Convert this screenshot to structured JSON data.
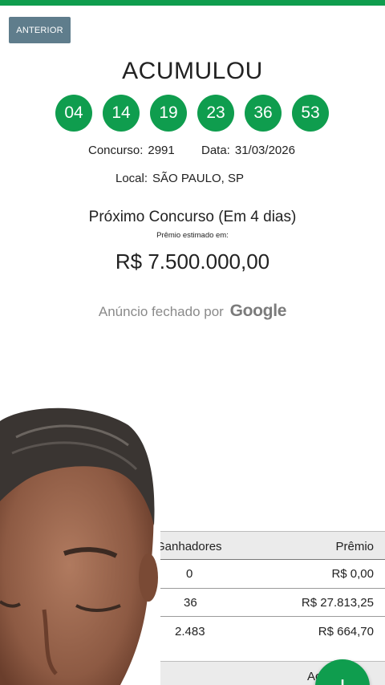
{
  "header": {
    "prev_button": "ANTERIOR"
  },
  "result": {
    "status": "ACUMULOU",
    "numbers": [
      "04",
      "14",
      "19",
      "23",
      "36",
      "53"
    ],
    "contest_label": "Concurso:",
    "contest_value": "2991",
    "date_label": "Data:",
    "date_value": "31/03/2026",
    "location_label": "Local:",
    "location_value": "SÃO PAULO, SP"
  },
  "next": {
    "title": "Próximo Concurso (Em 4 dias)",
    "subtitle": "Prêmio estimado em:",
    "prize": "R$ 7.500.000,00"
  },
  "ad": {
    "closed_text": "Anúncio fechado por",
    "brand": "Google"
  },
  "table": {
    "headers": [
      "Ganhadores",
      "Prêmio"
    ],
    "rows": [
      {
        "winners": "0",
        "prize": "R$ 0,00"
      },
      {
        "winners": "36",
        "prize": "R$ 27.813,25"
      },
      {
        "winners": "2.483",
        "prize": "R$ 664,70"
      }
    ],
    "footer_label": "Acumulado"
  },
  "fab": {
    "icon": "plus-icon",
    "label": "+"
  },
  "colors": {
    "accent": "#0f9d4e",
    "prev_button": "#5f7d8c",
    "header_bg": "#ebebeb"
  }
}
